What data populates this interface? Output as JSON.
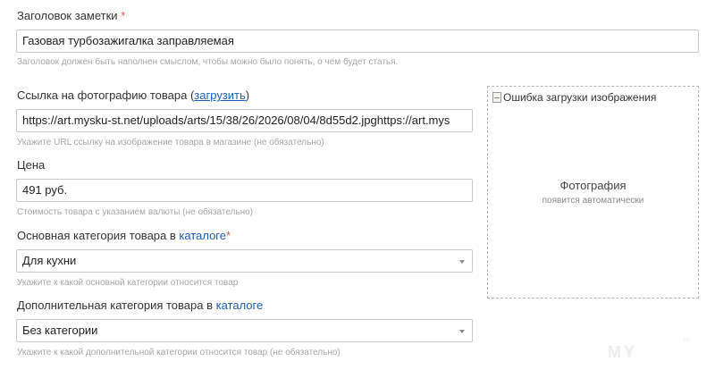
{
  "title_field": {
    "label": "Заголовок заметки",
    "required_mark": "*",
    "value": "Газовая турбозажигалка заправляемая",
    "hint": "Заголовок должен быть наполнен смыслом, чтобы можно было понять, о чем будет статья."
  },
  "photo_url_field": {
    "label": "Ссылка на фотографию товара (",
    "upload_link": "загрузить",
    "label_end": ")",
    "value": "https://art.mysku-st.net/uploads/arts/15/38/26/2026/08/04/8d55d2.jpghttps://art.mys",
    "hint": "Укажите URL ссылку на изображение товара в магазине (не обязательно)"
  },
  "price_field": {
    "label": "Цена",
    "value": "491 руб.",
    "hint": "Стоимость товара с указанием валюты (не обязательно)"
  },
  "main_category_field": {
    "label": "Основная категория товара в ",
    "catalog_link": "каталоге",
    "required_mark": "*",
    "selected": "Для кухни",
    "hint": "Укажите к какой основной категории относится товар"
  },
  "extra_category_field": {
    "label": "Дополнительная категория товара в ",
    "catalog_link": "каталоге",
    "selected": "Без категории",
    "hint": "Укажите к какой дополнительной категории относится товар (не обязательно)"
  },
  "photo_preview": {
    "broken_image_alt": "Ошибка загрузки изображения",
    "title": "Фотография",
    "subtitle": "появится автоматически"
  },
  "watermark": {
    "text": "MY",
    "sub": "ru"
  },
  "icons": {
    "dropdown": "chevron-down-icon",
    "broken_image": "broken-image-icon"
  }
}
